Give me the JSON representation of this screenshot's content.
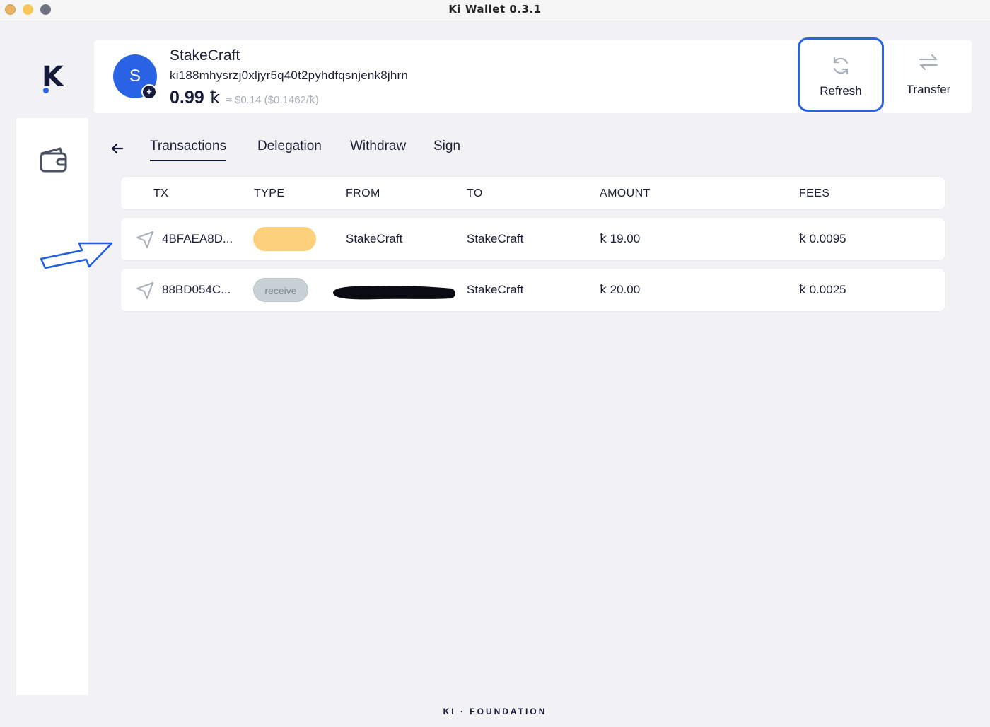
{
  "window": {
    "title": "Ki Wallet 0.3.1"
  },
  "sidebar": {
    "logo_letter": "K",
    "nav_icon": "wallet-icon"
  },
  "account": {
    "avatar_initial": "S",
    "name": "StakeCraft",
    "address": "ki188mhysrzj0xljyr5q40t2pyhdfqsnjenk8jhrn",
    "balance": "0.99",
    "currency_symbol": "ꝁ",
    "balance_usd": "≈ $0.14 ($0.1462/ꝁ)"
  },
  "actions": {
    "refresh_label": "Refresh",
    "transfer_label": "Transfer"
  },
  "tabs": [
    {
      "label": "Transactions",
      "active": true
    },
    {
      "label": "Delegation",
      "active": false
    },
    {
      "label": "Withdraw",
      "active": false
    },
    {
      "label": "Sign",
      "active": false
    }
  ],
  "table": {
    "columns": [
      "TX",
      "TYPE",
      "FROM",
      "TO",
      "AMOUNT",
      "FEES"
    ],
    "rows": [
      {
        "tx": "4BFAEA8D...",
        "type": "",
        "type_color": "#fdd07c",
        "from": "StakeCraft",
        "to": "StakeCraft",
        "amount": "ꝁ 19.00",
        "fees": "ꝁ 0.0095"
      },
      {
        "tx": "88BD054C...",
        "type": "receive",
        "type_color": "#c8d2d6",
        "from": "",
        "to": "StakeCraft",
        "amount": "ꝁ 20.00",
        "fees": "ꝁ 0.0025"
      }
    ]
  },
  "footer": {
    "brand": "KI · FOUNDATION"
  },
  "colors": {
    "accent": "#2a63e6",
    "dark": "#15193a",
    "background": "#f2f2f4"
  }
}
